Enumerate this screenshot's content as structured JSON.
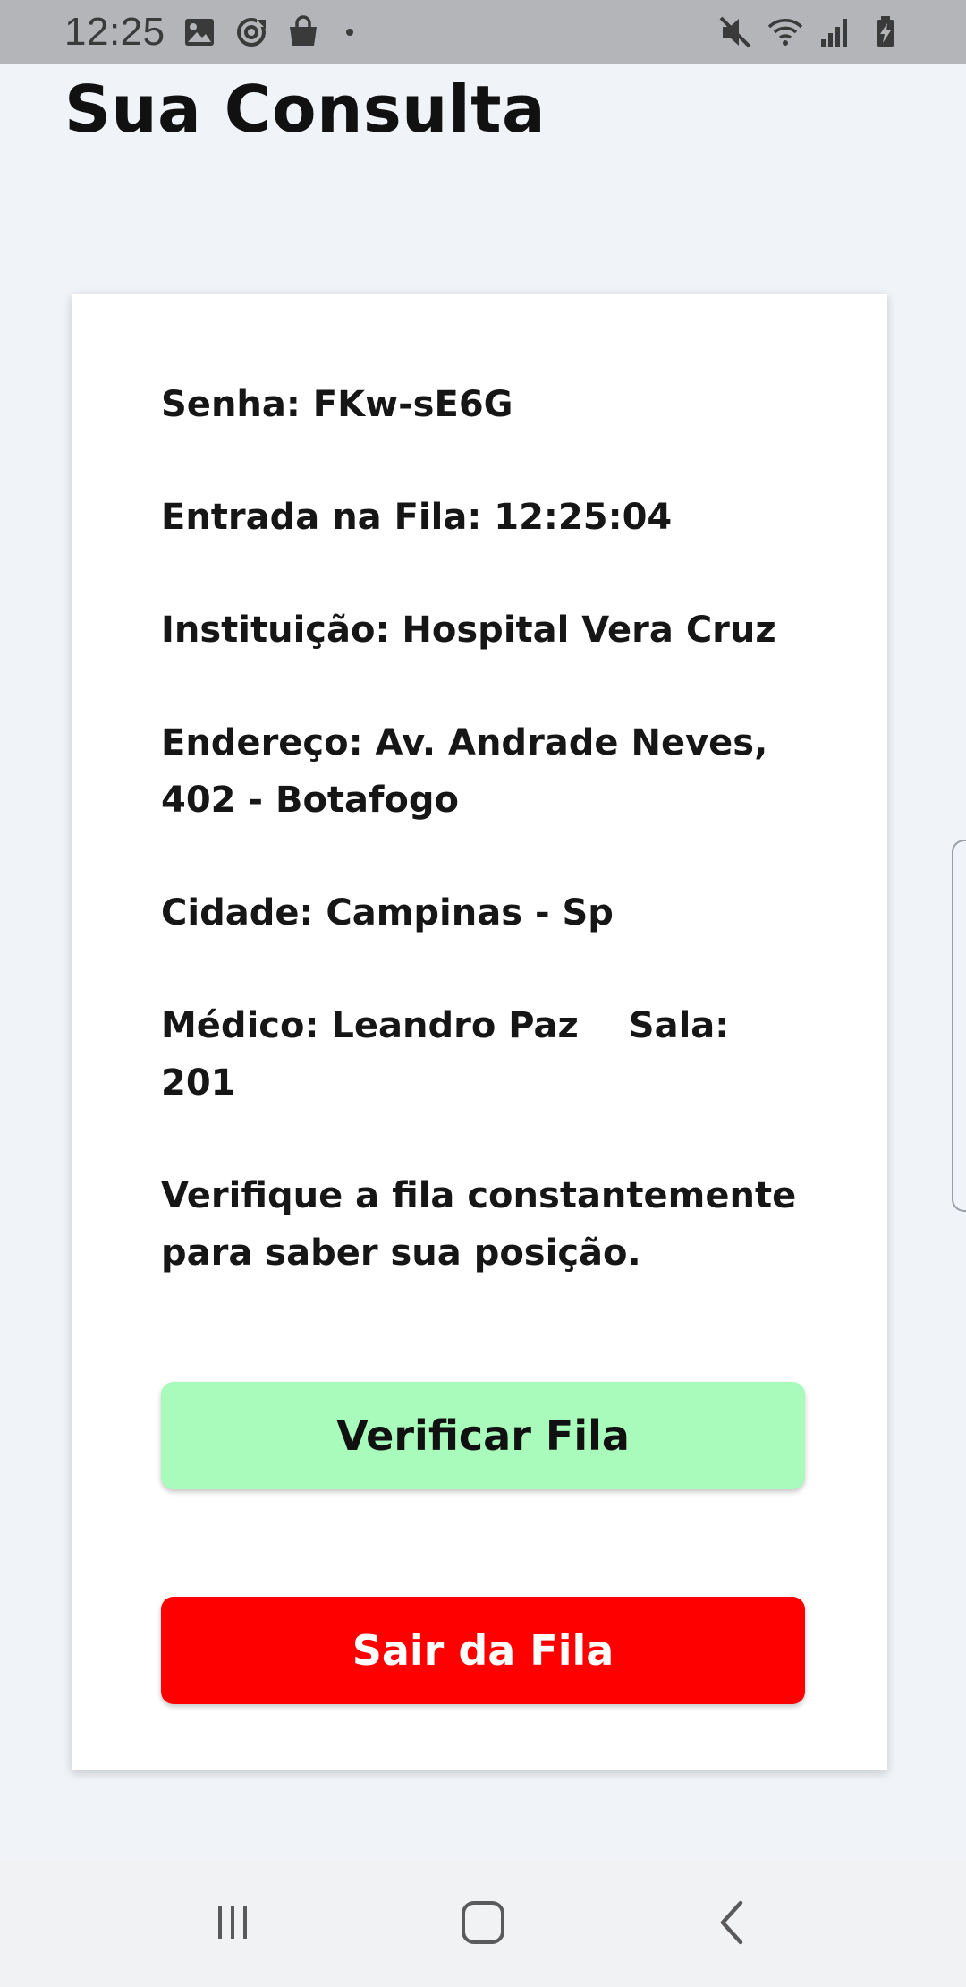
{
  "status_bar": {
    "time": "12:25",
    "left_icons": [
      "image-icon",
      "sync-icon",
      "shopping-bag-icon"
    ],
    "right_icons": [
      "mute-icon",
      "wifi-icon",
      "signal-icon",
      "battery-charging-icon"
    ]
  },
  "page": {
    "title": "Sua Consulta"
  },
  "consulta": {
    "senha": "Senha: FKw-sE6G",
    "entrada": "Entrada na Fila:  12:25:04",
    "instituicao": "Instituição: Hospital Vera Cruz",
    "endereco_1": "Endereço: Av. Andrade Neves,",
    "endereco_2": "402 - Botafogo",
    "cidade": "Cidade: Campinas - Sp",
    "medico": "Médico: Leandro Paz",
    "sala": "Sala: 201",
    "aviso_1": "Verifique a fila constantemente",
    "aviso_2": "para saber sua posição."
  },
  "actions": {
    "verify_label": "Verificar Fila",
    "exit_label": "Sair da Fila"
  },
  "colors": {
    "verify_bg": "#a8fbbb",
    "exit_bg": "#ff0000",
    "page_bg": "#f0f3f8"
  },
  "nav_bar": {
    "icons": [
      "recent-apps-icon",
      "home-icon",
      "back-icon"
    ]
  }
}
